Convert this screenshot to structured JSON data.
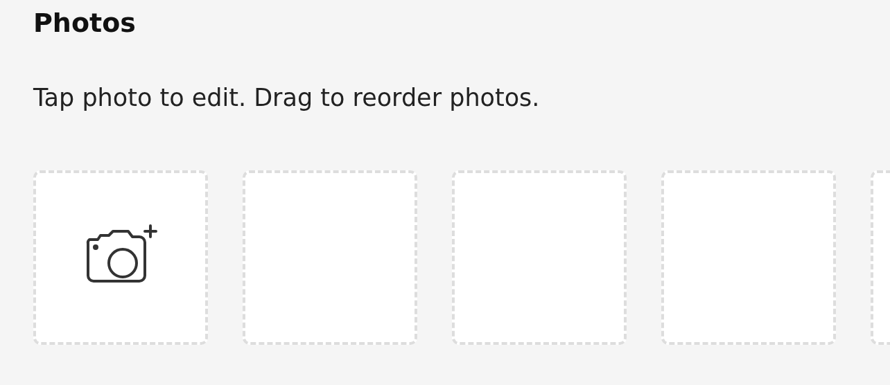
{
  "title": "Photos",
  "instructions": "Tap photo to edit. Drag to reorder photos.",
  "slots": [
    {
      "kind": "add"
    },
    {
      "kind": "empty"
    },
    {
      "kind": "empty"
    },
    {
      "kind": "empty"
    },
    {
      "kind": "empty"
    }
  ]
}
